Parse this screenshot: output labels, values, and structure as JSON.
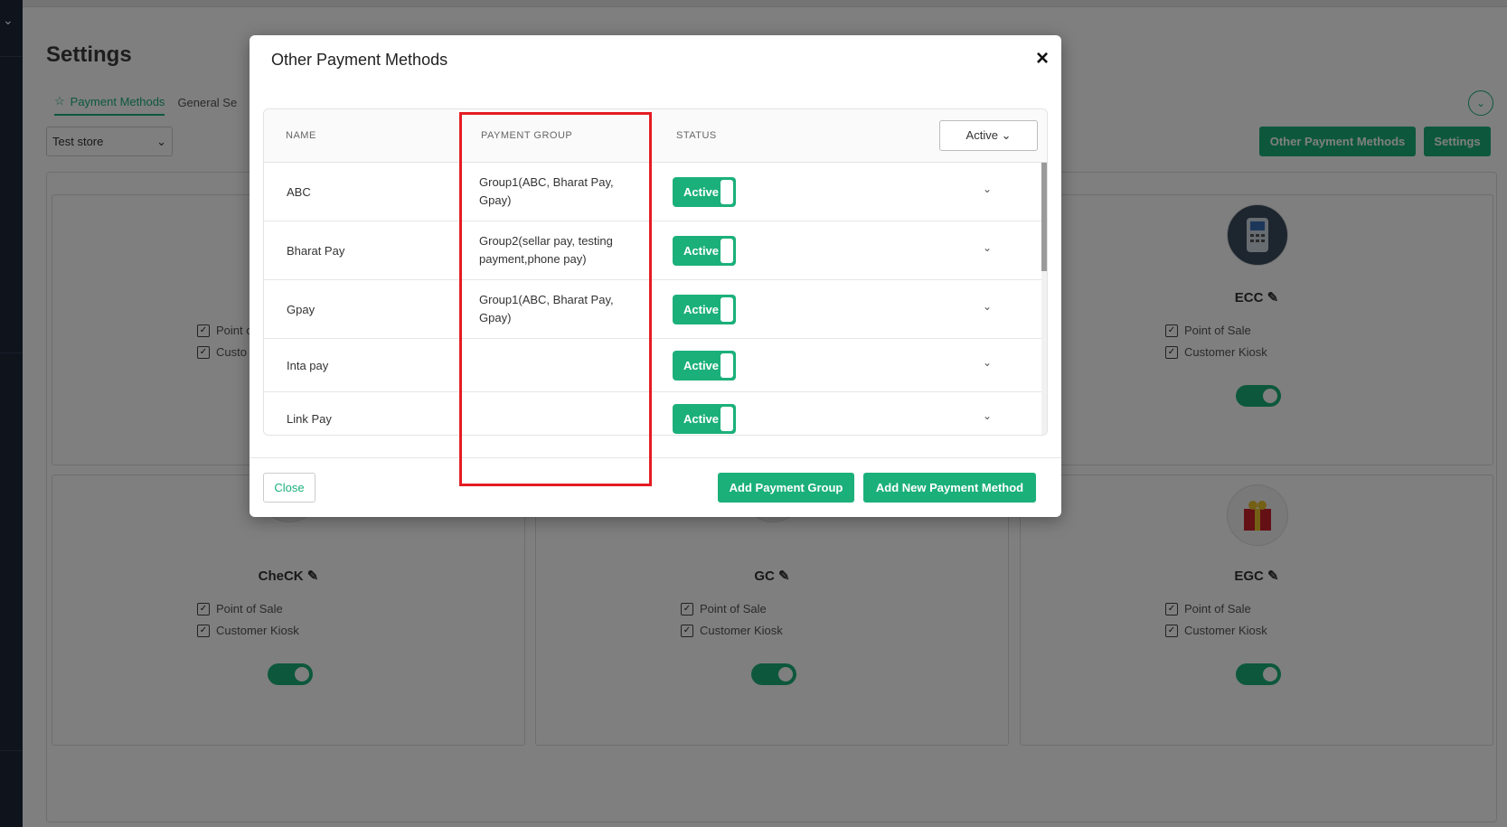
{
  "page": {
    "title": "Settings",
    "tabs": [
      {
        "label": "Payment Methods",
        "active": true
      },
      {
        "label": "General Se"
      }
    ],
    "store_select": "Test store",
    "header_buttons": {
      "other_payment_methods": "Other Payment Methods",
      "settings": "Settings"
    }
  },
  "cards": [
    {
      "title": "",
      "checks": [
        "Point o",
        "Custo"
      ]
    },
    {
      "title": "ECC",
      "checks": [
        "Point of Sale",
        "Customer Kiosk"
      ]
    },
    {
      "title": "CheCK",
      "checks": [
        "Point of Sale",
        "Customer Kiosk"
      ]
    },
    {
      "title": "GC",
      "checks": [
        "Point of Sale",
        "Customer Kiosk"
      ]
    },
    {
      "title": "EGC",
      "checks": [
        "Point of Sale",
        "Customer Kiosk"
      ]
    }
  ],
  "modal": {
    "title": "Other Payment Methods",
    "close_icon": "×",
    "columns": {
      "name": "NAME",
      "payment_group": "PAYMENT GROUP",
      "status": "STATUS"
    },
    "status_filter": "Active",
    "rows": [
      {
        "name": "ABC",
        "group": "Group1(ABC, Bharat Pay, Gpay)",
        "status": "Active"
      },
      {
        "name": "Bharat Pay",
        "group": "Group2(sellar pay, testing payment,phone pay)",
        "status": "Active"
      },
      {
        "name": "Gpay",
        "group": "Group1(ABC, Bharat Pay, Gpay)",
        "status": "Active"
      },
      {
        "name": "Inta pay",
        "group": "",
        "status": "Active"
      },
      {
        "name": "Link Pay",
        "group": "",
        "status": "Active"
      }
    ],
    "footer": {
      "close": "Close",
      "add_group": "Add Payment Group",
      "add_method": "Add New Payment Method"
    }
  },
  "colors": {
    "accent": "#1bb07a",
    "highlight": "#e41c24"
  }
}
